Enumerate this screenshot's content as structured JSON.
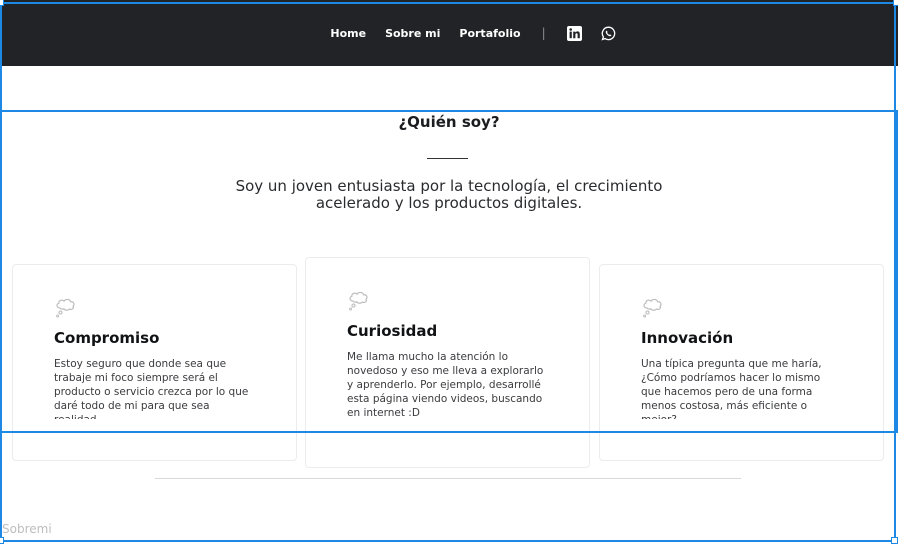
{
  "nav": {
    "links": [
      "Home",
      "Sobre mi",
      "Portafolio"
    ],
    "separator": "|",
    "social": [
      {
        "icon": "linkedin-icon"
      },
      {
        "icon": "whatsapp-icon"
      }
    ]
  },
  "about": {
    "title": "¿Quién soy?",
    "lead": "Soy un joven entusiasta por la tecnología, el crecimiento acelerado y los productos digitales.",
    "cards": [
      {
        "icon": "thought-bubble-icon",
        "title": "Compromiso",
        "text": "Estoy seguro que donde sea que trabaje mi foco siempre será el producto o servicio crezca por lo que daré todo de mi para que sea realidad."
      },
      {
        "icon": "thought-bubble-icon",
        "title": "Curiosidad",
        "text": "Me llama mucho la atención lo novedoso y eso me lleva a explorarlo y aprenderlo. Por ejemplo, desarrollé esta página viendo videos, buscando en internet :D"
      },
      {
        "icon": "thought-bubble-icon",
        "title": "Innovación",
        "text": "Una típica pregunta que me haría, ¿Cómo podríamos hacer lo mismo que hacemos pero de una forma menos costosa, más eficiente o mejor?"
      }
    ]
  },
  "footer_label": "Sobremi",
  "colors": {
    "navbar": "#222327",
    "selection": "#1e88e5"
  }
}
